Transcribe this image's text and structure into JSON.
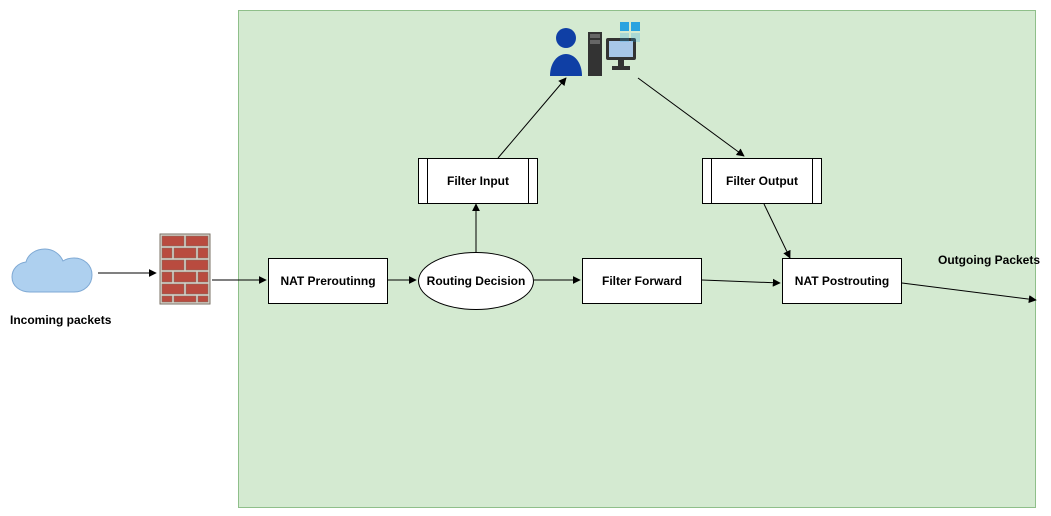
{
  "labels": {
    "incoming": "Incoming packets",
    "outgoing": "Outgoing Packets"
  },
  "nodes": {
    "nat_prerouting": "NAT Preroutinng",
    "routing_decision": "Routing Decision",
    "filter_input": "Filter Input",
    "filter_forward": "Filter Forward",
    "filter_output": "Filter Output",
    "nat_postrouting": "NAT Postrouting"
  },
  "icons": {
    "cloud": "cloud-icon",
    "firewall": "firewall-icon",
    "user_computer": "user-computer-icon"
  },
  "colors": {
    "panel_bg": "#d4ead1",
    "panel_border": "#8fbf8a",
    "cloud": "#9ec6ef",
    "brick": "#b94b3f",
    "brick_mortar": "#d9d3c9",
    "user": "#0f3fa5",
    "monitor": "#333333",
    "win": "#29a3e0"
  },
  "edges": [
    {
      "from": "cloud",
      "to": "firewall"
    },
    {
      "from": "firewall",
      "to": "nat_prerouting"
    },
    {
      "from": "nat_prerouting",
      "to": "routing_decision"
    },
    {
      "from": "routing_decision",
      "to": "filter_input"
    },
    {
      "from": "routing_decision",
      "to": "filter_forward"
    },
    {
      "from": "filter_input",
      "to": "user_computer"
    },
    {
      "from": "user_computer",
      "to": "filter_output"
    },
    {
      "from": "filter_forward",
      "to": "nat_postrouting"
    },
    {
      "from": "filter_output",
      "to": "nat_postrouting"
    },
    {
      "from": "nat_postrouting",
      "to": "outgoing"
    }
  ]
}
